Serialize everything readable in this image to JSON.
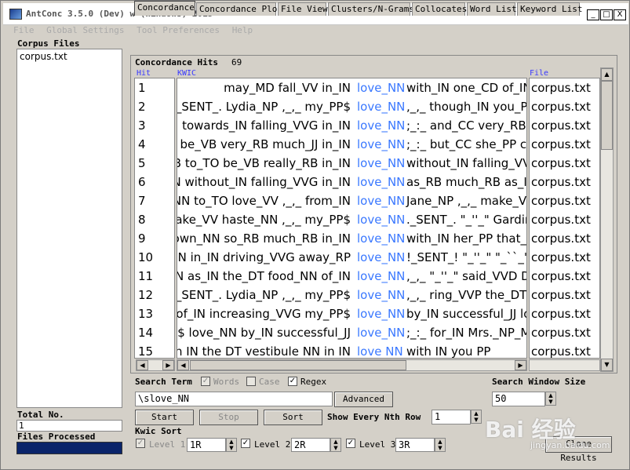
{
  "window": {
    "title": "AntConc 3.5.0 (Dev) w (Windows) 2015",
    "min": "_",
    "max": "□",
    "close": "X"
  },
  "menu": [
    "File",
    "Global Settings",
    "Tool Preferences",
    "Help"
  ],
  "sidebar": {
    "title": "Corpus Files",
    "files": [
      "corpus.txt"
    ],
    "total_label": "Total No.",
    "total_value": "1",
    "processed_label": "Files Processed"
  },
  "tabs": [
    "Concordance",
    "Concordance Plot",
    "File View",
    "Clusters/N-Grams",
    "Collocates",
    "Word List",
    "Keyword List"
  ],
  "concordance": {
    "hits_label": "Concordance Hits",
    "hits_value": "69",
    "columns": {
      "hit": "Hit",
      "kwic": "KWIC",
      "file": "File"
    },
    "rows": [
      {
        "hit": "1",
        "left": "may_MD fall_VV in_IN",
        "kw": "love_NN",
        "right": "with_IN one_CD of_IN",
        "file": "corpus.txt"
      },
      {
        "hit": "2",
        "left": "N ._SENT_. Lydia_NP ,_,_ my_PP$",
        "kw": "love_NN",
        "right": ",_,_ though_IN you_PP",
        "file": "corpus.txt"
      },
      {
        "hit": "3",
        "left": "N towards_IN falling_VVG in_IN",
        "kw": "love_NN",
        "right": ";_:_ and_CC very_RB li",
        "file": "corpus.txt"
      },
      {
        "hit": "4",
        "left": "O be_VB very_RB much_JJ in_IN",
        "kw": "love_NN",
        "right": ";_:_ but_CC she_PP co",
        "file": "corpus.txt"
      },
      {
        "hit": "5",
        "left": "RB to_TO be_VB really_RB in_IN",
        "kw": "love_NN",
        "right": "without_IN falling_VVG",
        "file": "corpus.txt"
      },
      {
        "hit": "6",
        "left": "N without_IN falling_VVG in_IN",
        "kw": "love_NN",
        "right": "as_RB much_RB as_IN",
        "file": "corpus.txt"
      },
      {
        "hit": "7",
        "left": "_NN to_TO love_VV ,_,_ from_IN",
        "kw": "love_NN",
        "right": "Jane_NP ,_,_ make_VV",
        "file": "corpus.txt"
      },
      {
        "hit": "8",
        "left": "make_VV haste_NN ,_,_ my_PP$",
        "kw": "love_NN",
        "right": "._SENT_. \"_''_\" Gardine",
        "file": "corpus.txt"
      },
      {
        "hit": "9",
        "left": "town_NN so_RB much_RB in_IN",
        "kw": "love_NN",
        "right": "with_IN her_PP that_IN",
        "file": "corpus.txt"
      },
      {
        "hit": "10",
        "left": "NN in_IN driving_VVG away_RP",
        "kw": "love_NN",
        "right": "!_SENT_! \"_''_\" \"_``_\" I_",
        "file": "corpus.txt"
      },
      {
        "hit": "11",
        "left": "NN as_IN the_DT food_NN of_IN",
        "kw": "love_NN",
        "right": ",_,_ \"_''_\" said_VVD Da",
        "file": "corpus.txt"
      },
      {
        "hit": "12",
        "left": "y ._SENT_. Lydia_NP ,_,_ my_PP$",
        "kw": "love_NN",
        "right": ",_,_ ring_VVP the_DT b",
        "file": "corpus.txt"
      },
      {
        "hit": "13",
        "left": "N of_IN increasing_VVG my_PP$",
        "kw": "love_NN",
        "right": "by_IN successful_JJ lo",
        "file": "corpus.txt"
      },
      {
        "hit": "14",
        "left": "P$ love_NN by_IN successful_JJ",
        "kw": "love_NN",
        "right": ";_:_ for_IN Mrs._NP_M",
        "file": "corpus.txt"
      },
      {
        "hit": "15",
        "left": "n IN the DT vestibule NN in IN",
        "kw": "love NN",
        "right": "with IN you PP",
        "file": "corpus.txt"
      }
    ]
  },
  "search": {
    "term_label": "Search Term",
    "words_label": "Words",
    "case_label": "Case",
    "regex_label": "Regex",
    "term_value": "\\slove_NN",
    "advanced_label": "Advanced",
    "window_label": "Search Window Size",
    "window_value": "50",
    "start_label": "Start",
    "stop_label": "Stop",
    "sort_label": "Sort",
    "nth_label": "Show Every Nth Row",
    "nth_value": "1"
  },
  "kwic_sort": {
    "title": "Kwic Sort",
    "level1_label": "Level 1",
    "level1_value": "1R",
    "level2_label": "Level 2",
    "level2_value": "2R",
    "level3_label": "Level 3",
    "level3_value": "3R",
    "clone_label": "Clone Results"
  },
  "watermark": {
    "main": "Bai 经验",
    "sub": "jingyan.baidu.com"
  }
}
